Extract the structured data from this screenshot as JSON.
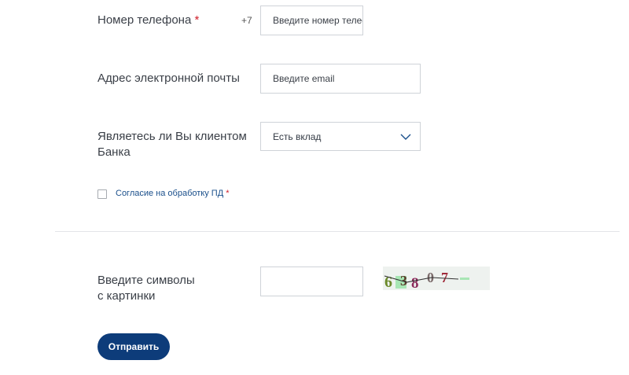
{
  "phone": {
    "label": "Номер телефона",
    "required_mark": "*",
    "prefix": "+7",
    "placeholder": "Введите номер телефона"
  },
  "email": {
    "label": "Адрес электронной почты",
    "placeholder": "Введите email"
  },
  "client": {
    "label_line1": "Являетесь ли Вы клиентом",
    "label_line2": "Банка",
    "selected_value": "Есть вклад",
    "chevron_icon": "chevron-down-icon"
  },
  "consent": {
    "label": "Согласие на обработку ПД",
    "required_mark": "*",
    "checked": false
  },
  "captcha": {
    "label_line1": "Введите символы",
    "label_line2": "с картинки",
    "value": "",
    "image_text": "63807"
  },
  "submit": {
    "label": "Отправить"
  },
  "colors": {
    "accent": "#0d3c7a",
    "required": "#d0202c",
    "link": "#1a4f8b",
    "border": "#cfd3d8"
  }
}
